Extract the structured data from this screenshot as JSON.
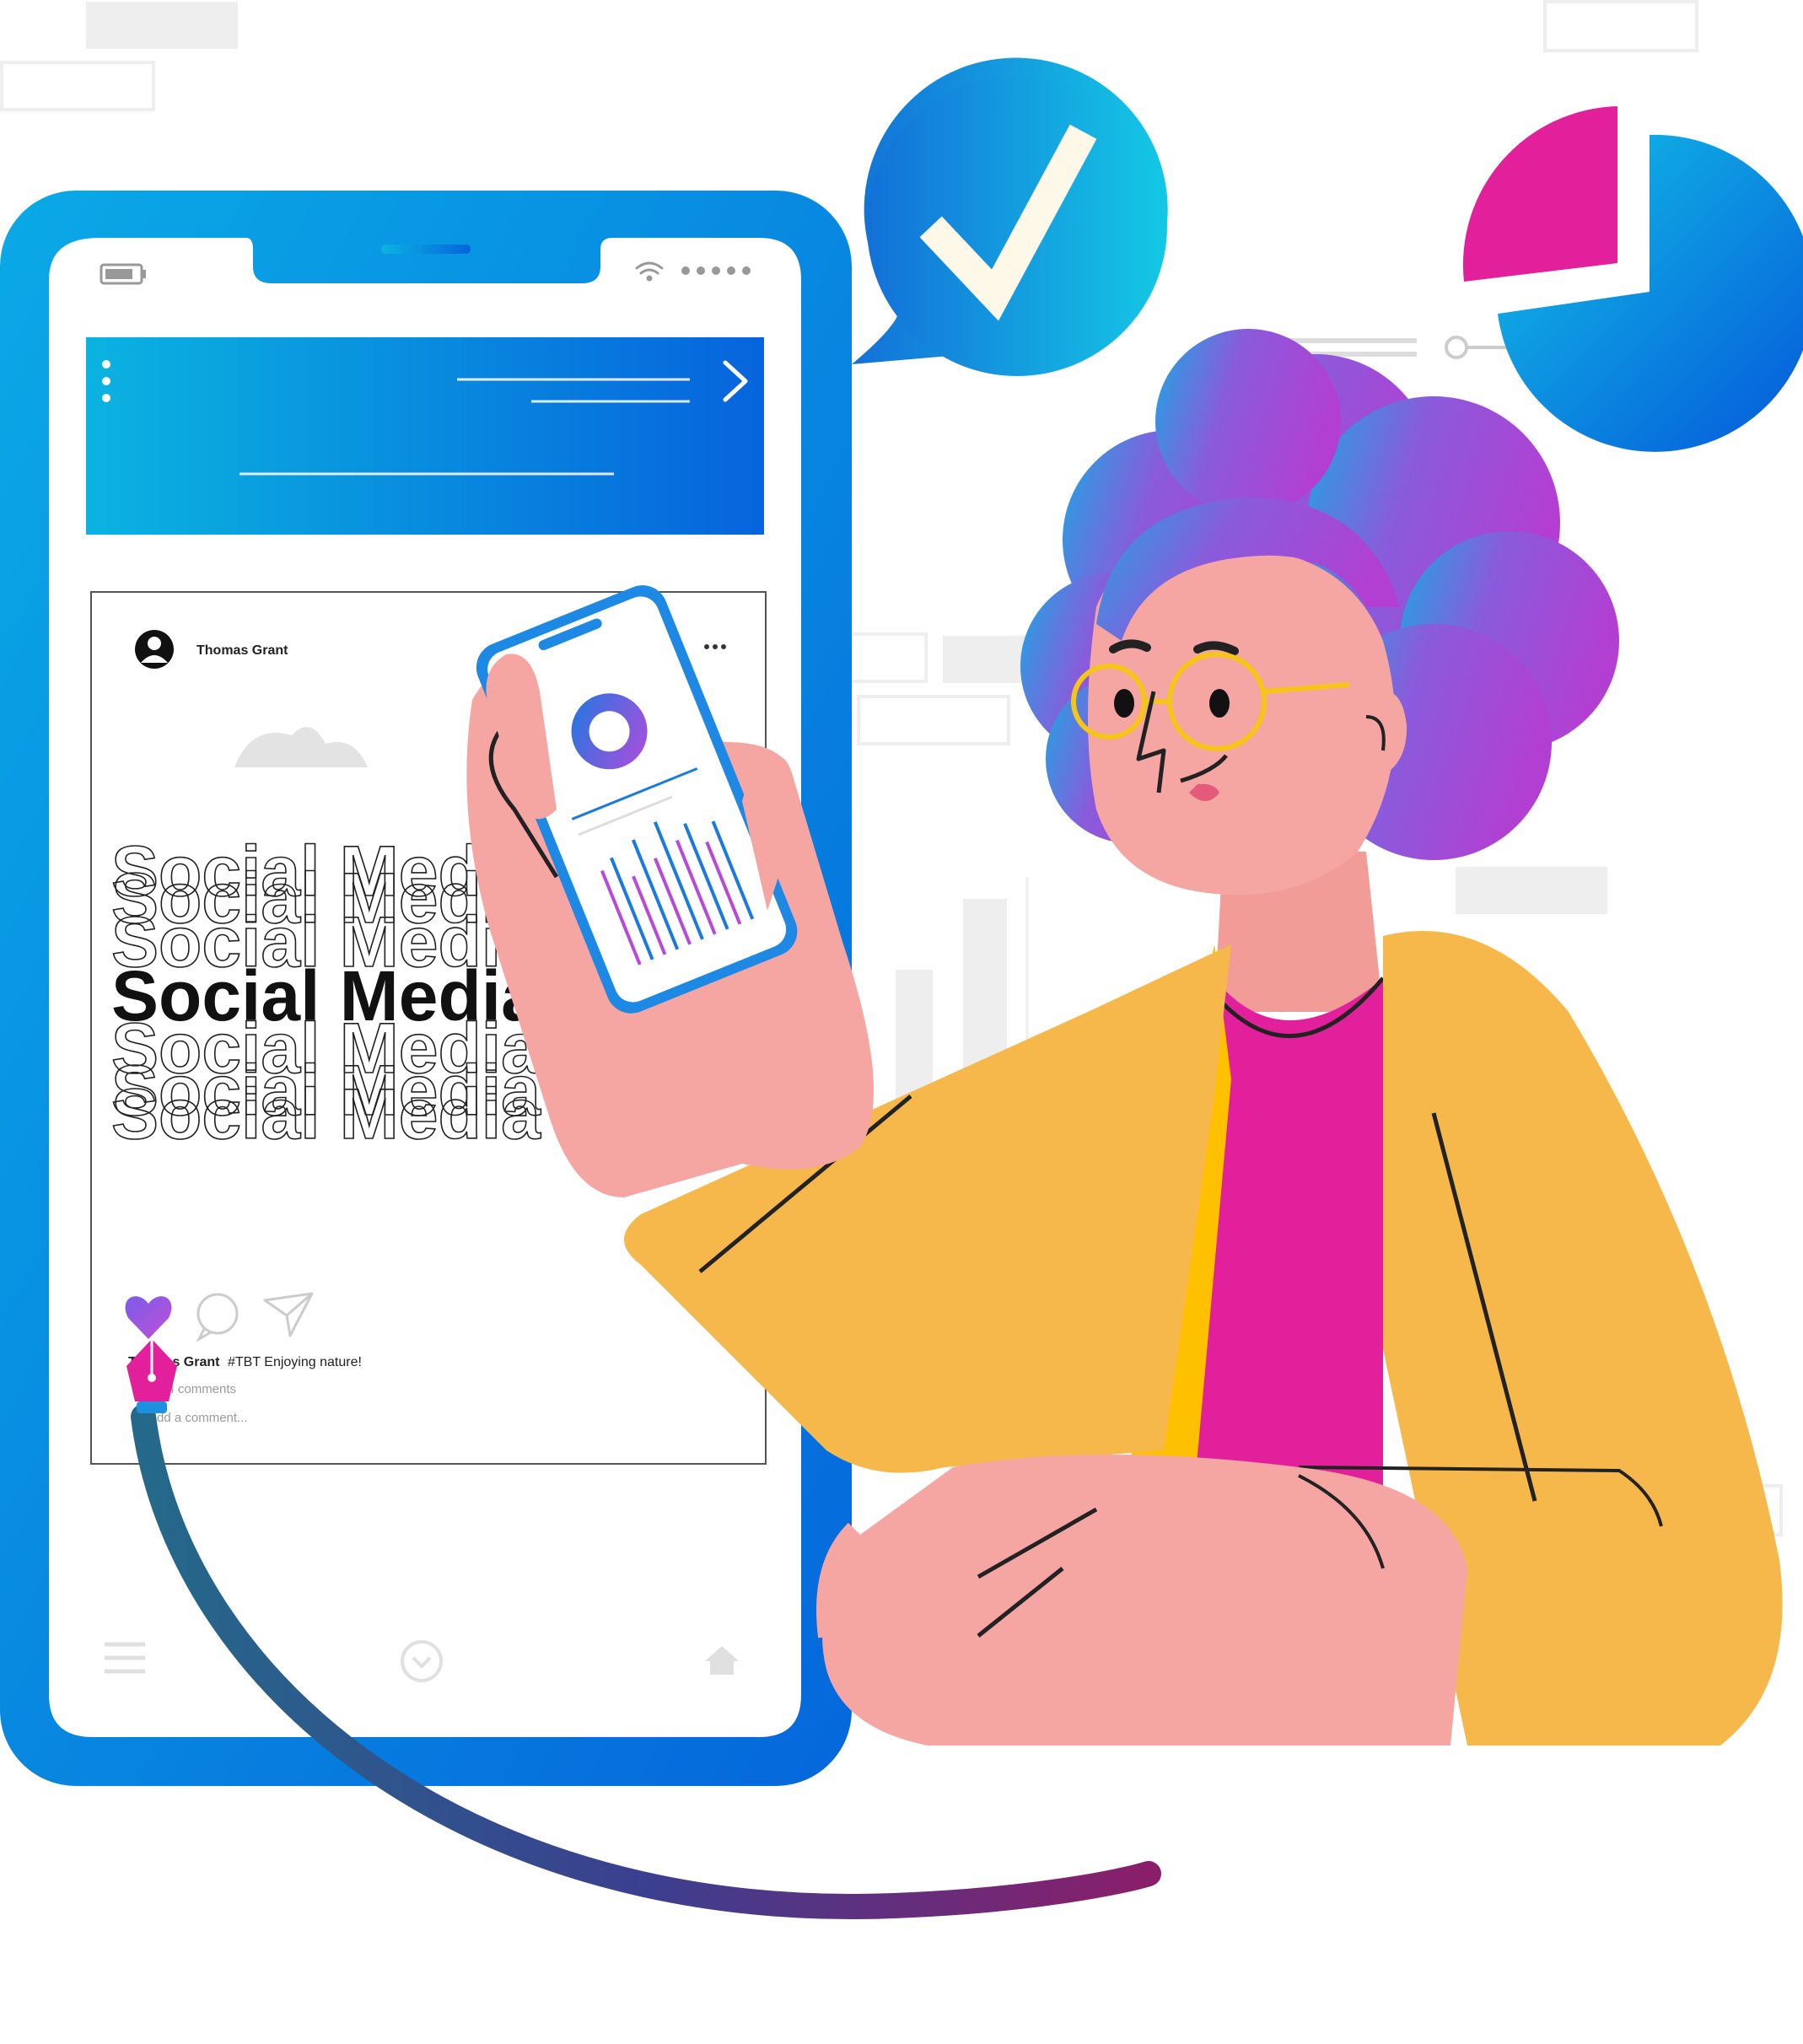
{
  "post": {
    "username": "Thomas Grant",
    "headline": "Social Media",
    "caption_user": "Thomas Grant",
    "caption_text": "#TBT  Enjoying nature!",
    "comments": "24 comments",
    "comment_placeholder": "Add a comment..."
  },
  "colors": {
    "phone_blue": "#0a8ad8",
    "accent_pink": "#e3209b",
    "jacket_yellow": "#f6b84b",
    "skin": "#f5a6a3",
    "hair_purple": "#9b4fd6"
  },
  "icons": [
    "checkmark-icon",
    "pie-chart-icon",
    "heart-icon",
    "comment-icon",
    "share-icon",
    "menu-icon",
    "chevron-down-icon",
    "home-icon",
    "pen-tool-icon"
  ]
}
